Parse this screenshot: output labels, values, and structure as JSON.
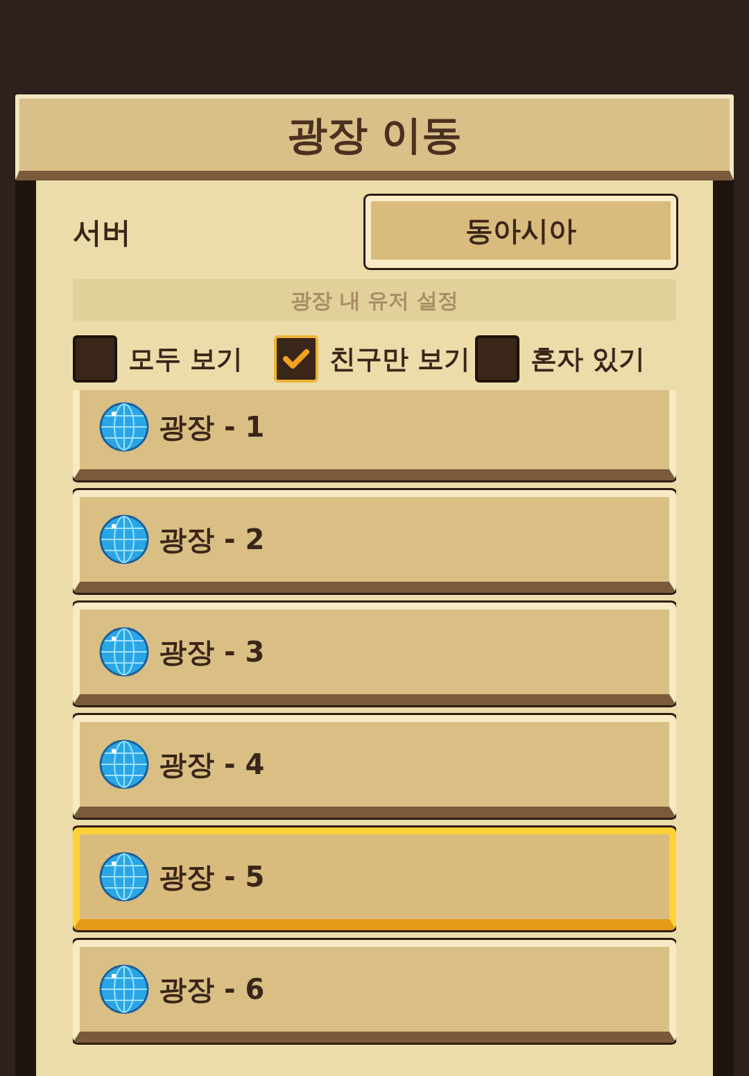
{
  "title": "광장 이동",
  "server": {
    "label": "서버",
    "value": "동아시아"
  },
  "user_settings": {
    "title": "광장 내 유저 설정",
    "options": [
      {
        "label": "모두 보기",
        "selected": false
      },
      {
        "label": "친구만 보기",
        "selected": true
      },
      {
        "label": "혼자 있기",
        "selected": false
      }
    ]
  },
  "plazas": [
    {
      "label": "광장 - 1",
      "selected": false
    },
    {
      "label": "광장 - 2",
      "selected": false
    },
    {
      "label": "광장 - 3",
      "selected": false
    },
    {
      "label": "광장 - 4",
      "selected": false
    },
    {
      "label": "광장 - 5",
      "selected": true
    },
    {
      "label": "광장 - 6",
      "selected": false
    }
  ]
}
